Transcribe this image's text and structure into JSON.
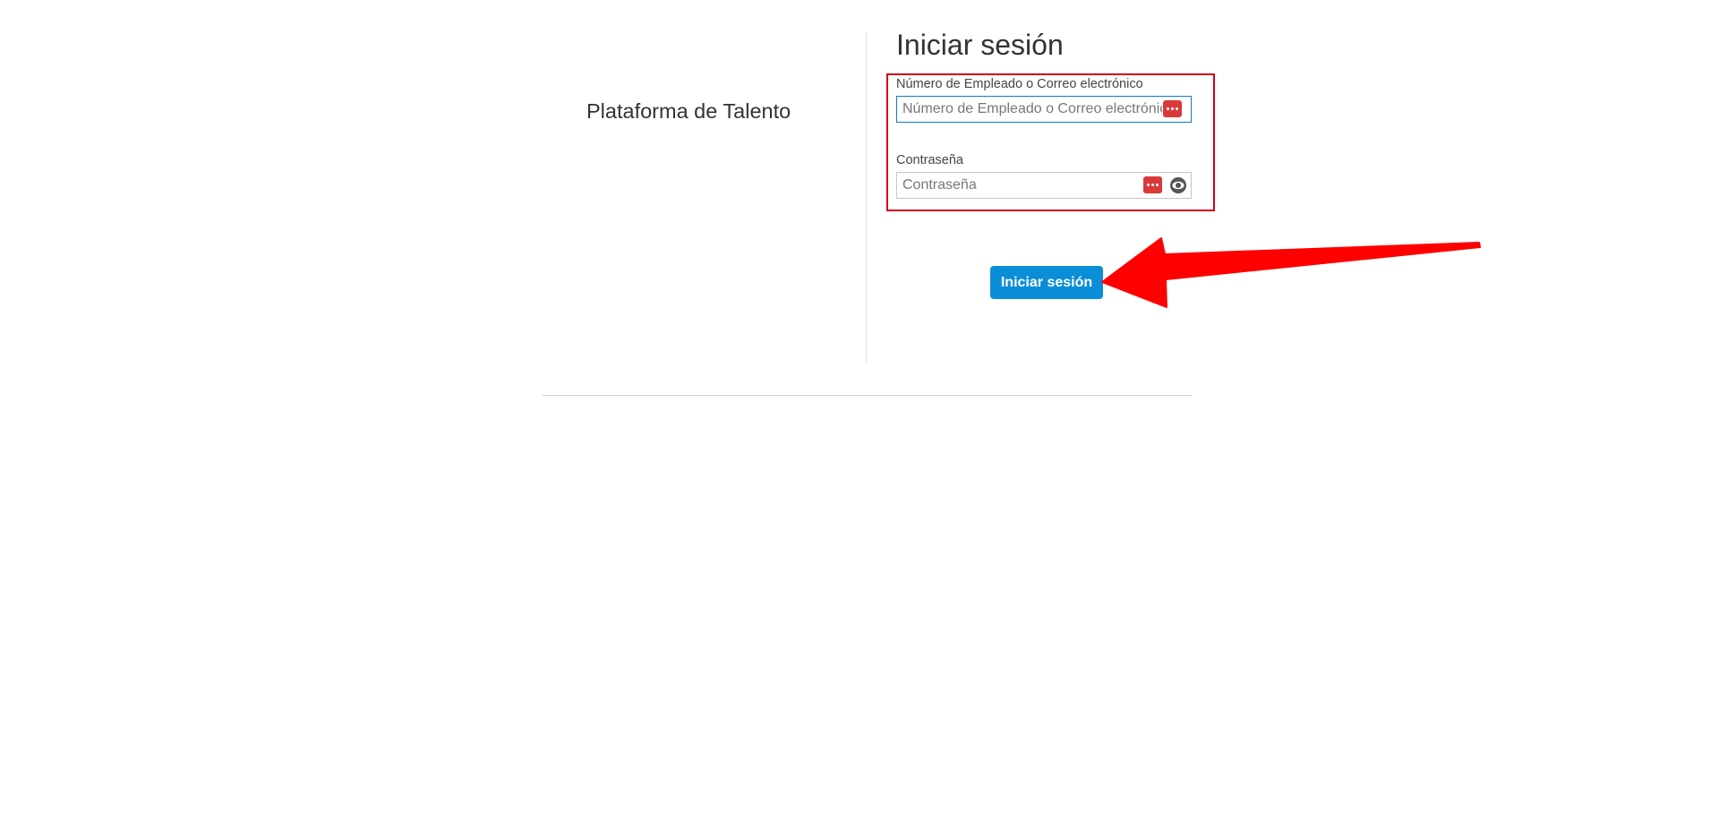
{
  "brand": {
    "text": "Plataforma de Talento"
  },
  "login": {
    "title": "Iniciar sesión",
    "user_field": {
      "label": "Número de Empleado o Correo electrónico",
      "placeholder": "Número de Empleado o Correo electrónico",
      "value": ""
    },
    "password_field": {
      "label": "Contraseña",
      "placeholder": "Contraseña",
      "value": ""
    },
    "submit_label": "Iniciar sesión"
  },
  "annotations": {
    "highlight_color": "#d0021b",
    "arrow_color": "#ff0000"
  },
  "colors": {
    "button": "#0a8ed8",
    "password_manager_icon": "#d83a3a"
  },
  "icons": {
    "password_manager": "password-manager-icon",
    "show_password": "eye-icon"
  }
}
